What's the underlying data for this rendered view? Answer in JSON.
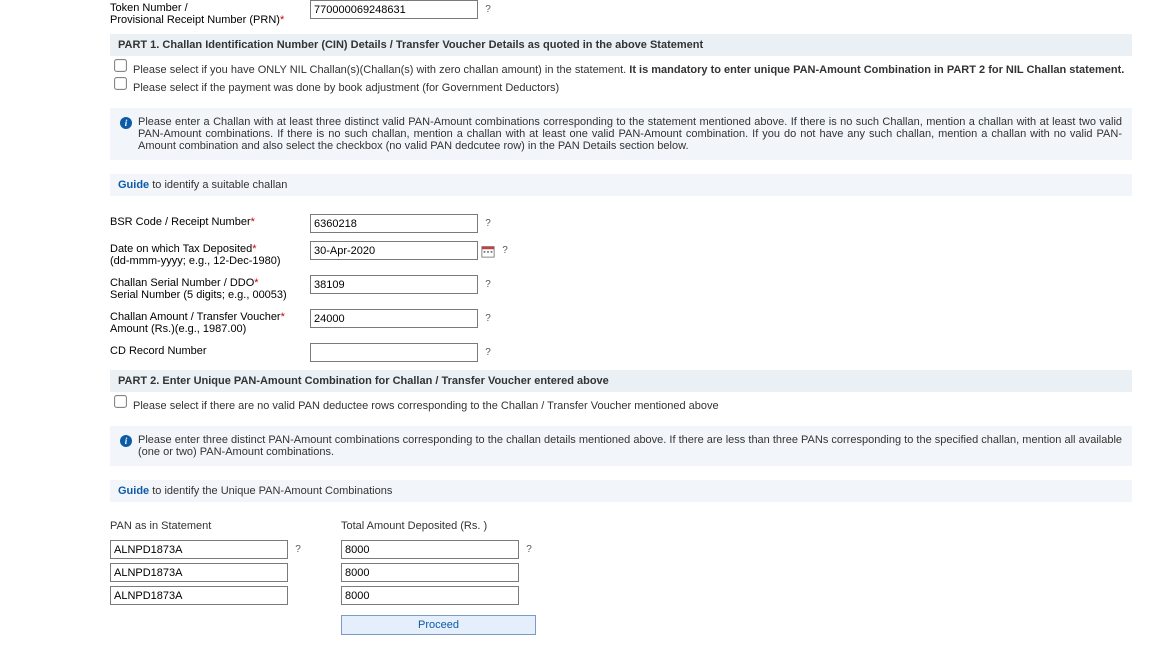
{
  "token": {
    "label_line1": "Token Number /",
    "label_line2": "Provisional Receipt Number (PRN)",
    "value": "770000069248631"
  },
  "part1": {
    "header": "PART 1. Challan Identification Number (CIN) Details / Transfer Voucher Details as quoted in the above Statement",
    "nil_check": "Please select if you have ONLY NIL Challan(s)(Challan(s) with zero challan amount) in the statement. ",
    "nil_check_bold": "It is mandatory to enter unique PAN-Amount Combination in PART 2 for NIL Challan statement.",
    "book_adj_check": "Please select if the payment was done by book adjustment (for Government Deductors)",
    "info": "Please enter a Challan with at least three distinct valid PAN-Amount combinations corresponding to the statement mentioned above. If there is no such Challan, mention a challan with at least two valid PAN-Amount combinations. If there is no such challan, mention a challan with at least one valid PAN-Amount combination. If you do not have any such challan, mention a challan with no valid PAN-Amount combination and also select the checkbox (no valid PAN dedcutee row) in the PAN Details section below.",
    "guide_link": "Guide",
    "guide_text": " to identify a suitable challan",
    "bsr": {
      "label": "BSR Code / Receipt Number",
      "value": "6360218"
    },
    "date": {
      "label": "Date on which Tax Deposited",
      "hint": "(dd-mmm-yyyy; e.g., 12-Dec-1980)",
      "value": "30-Apr-2020"
    },
    "serial": {
      "label": "Challan Serial Number / DDO",
      "hint": "Serial Number (5 digits; e.g., 00053)",
      "value": "38109"
    },
    "amount": {
      "label": "Challan Amount / Transfer Voucher",
      "hint": "Amount (Rs.)(e.g., 1987.00)",
      "value": "24000"
    },
    "cd": {
      "label": "CD Record Number",
      "value": ""
    }
  },
  "part2": {
    "header": "PART 2. Enter Unique PAN-Amount Combination for Challan / Transfer Voucher entered above",
    "noval_check": "Please select if there are no valid PAN deductee rows corresponding to the Challan / Transfer Voucher mentioned above",
    "info": "Please enter three distinct PAN-Amount combinations corresponding to the challan details mentioned above. If there are less than three PANs corresponding to the specified challan, mention all available (one or two) PAN-Amount combinations.",
    "guide_link": "Guide",
    "guide_text": " to identify the Unique PAN-Amount Combinations",
    "pan_header": "PAN as in Statement",
    "amt_header": "Total Amount Deposited (Rs. )",
    "rows": [
      {
        "pan": "ALNPD1873A",
        "amt": "8000"
      },
      {
        "pan": "ALNPD1873A",
        "amt": "8000"
      },
      {
        "pan": "ALNPD1873A",
        "amt": "8000"
      }
    ],
    "proceed": "Proceed"
  }
}
